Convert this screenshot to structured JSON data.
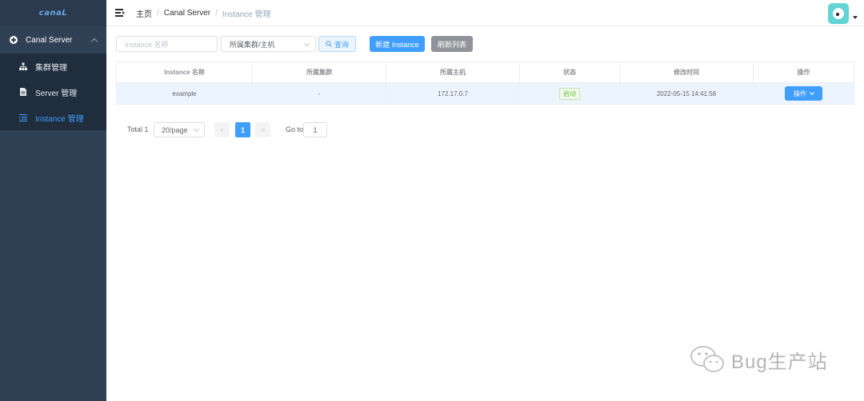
{
  "sidebar": {
    "logo": "canaL",
    "parent": {
      "label": "Canal Server"
    },
    "items": [
      {
        "label": "集群管理",
        "icon": "cluster-icon"
      },
      {
        "label": "Server 管理",
        "icon": "server-icon"
      },
      {
        "label": "Instance 管理",
        "icon": "list-icon",
        "active": true
      }
    ]
  },
  "header": {
    "breadcrumb": [
      "主页",
      "Canal Server",
      "Instance 管理"
    ],
    "separator": "/"
  },
  "filters": {
    "name_placeholder": "Instance 名称",
    "cluster_value": "所属集群/主机",
    "query_label": "查询",
    "new_label": "新建 Instance",
    "refresh_label": "刷新列表"
  },
  "table": {
    "columns": [
      "Instance 名称",
      "所属集群",
      "所属主机",
      "状态",
      "修改时间",
      "操作"
    ],
    "rows": [
      {
        "name": "example",
        "cluster": "-",
        "host": "172.17.0.7",
        "status": "启动",
        "modified": "2022-05-15 14:41:58",
        "action": "操作"
      }
    ]
  },
  "pagination": {
    "total": "Total 1",
    "page_size": "20/page",
    "prev": "<",
    "current": "1",
    "next": ">",
    "goto_label": "Go to",
    "goto_value": "1"
  },
  "watermark": {
    "text": "Bug生产站"
  },
  "colors": {
    "sidebar": "#304156",
    "primary": "#409eff",
    "success": "#67c23a",
    "info": "#909399"
  }
}
